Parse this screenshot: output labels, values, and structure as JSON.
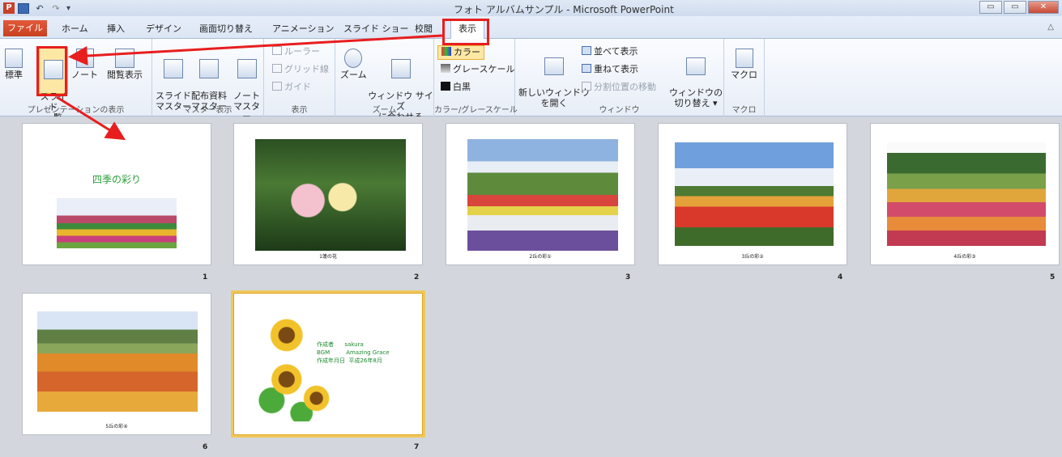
{
  "window": {
    "title": "フォト アルバムサンプル - Microsoft PowerPoint",
    "app_icon": "P"
  },
  "qat": {
    "undo": "↶",
    "redo": "↷",
    "more": "▾"
  },
  "window_controls": {
    "min": "▭",
    "max": "▭",
    "close": "✕"
  },
  "tabs": {
    "file": "ファイル",
    "home": "ホーム",
    "insert": "挿入",
    "design": "デザイン",
    "transitions": "画面切り替え",
    "animations": "アニメーション",
    "slideshow": "スライド ショー",
    "review": "校閲",
    "view": "表示"
  },
  "collapse": "△",
  "ribbon": {
    "presentation_views": {
      "label": "プレゼンテーションの表示",
      "normal": "標準",
      "sorter": "スライド\n一覧",
      "notes": "ノート",
      "reading": "閲覧表示"
    },
    "master_views": {
      "label": "マスター表示",
      "slide_master": "スライド\nマスター",
      "handout_master": "配布資料\nマスター",
      "notes_master": "ノート\nマスター"
    },
    "show": {
      "label": "表示",
      "ruler": "ルーラー",
      "gridlines": "グリッド線",
      "guides": "ガイド"
    },
    "zoom": {
      "label": "ズーム",
      "zoom": "ズーム",
      "fit": "ウィンドウ サイズ\nに合わせる"
    },
    "color": {
      "label": "カラー/グレースケール",
      "color": "カラー",
      "grayscale": "グレースケール",
      "bw": "白黒"
    },
    "window": {
      "label": "ウィンドウ",
      "new_window": "新しいウィンドウ\nを開く",
      "arrange_all": "並べて表示",
      "cascade": "重ねて表示",
      "move_split": "分割位置の移動",
      "switch": "ウィンドウの\n切り替え ▾"
    },
    "macros": {
      "label": "マクロ",
      "macros": "マクロ"
    }
  },
  "slides": [
    {
      "num": "1",
      "title": "四季の彩り",
      "caption": ""
    },
    {
      "num": "2",
      "caption": "1蓮の花"
    },
    {
      "num": "3",
      "caption": "2丘の彩①"
    },
    {
      "num": "4",
      "caption": "3丘の彩②"
    },
    {
      "num": "5",
      "caption": "4丘の彩③"
    },
    {
      "num": "6",
      "caption": "5丘の彩④"
    },
    {
      "num": "7",
      "caption": "",
      "credits": [
        {
          "k": "作成者",
          "v": "sakura"
        },
        {
          "k": "BGM",
          "v": "Amazing Grace"
        },
        {
          "k": "作成年月日",
          "v": "平成26年8月"
        }
      ]
    }
  ],
  "colors": {
    "annotation": "#e81e1e",
    "file_tab": "#d24726",
    "selection": "#f0c75e",
    "title_green": "#2a9d3a"
  }
}
